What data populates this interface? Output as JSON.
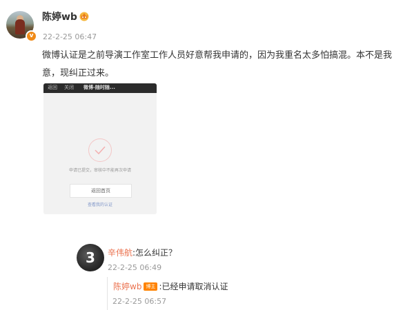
{
  "post": {
    "username": "陈婷wb",
    "verified_badge": "v",
    "time": "22-2-25 06:47",
    "content": "微博认证是之前导演工作室工作人员好意帮我申请的，因为我重名太多怕搞混。本不是我意，现纠正过来。",
    "screenshot": {
      "nav_back": "返回",
      "nav_close": "关闭",
      "nav_title": "微博-随时随...",
      "message": "申请已提交，审核中不能再次申请",
      "button": "返回首页",
      "link": "查看我的认证"
    }
  },
  "comment": {
    "avatar_text": "3",
    "username": "辛伟航",
    "text": ":怎么纠正？",
    "time": "22-2-25 06:49"
  },
  "reply": {
    "username": "陈婷wb",
    "tag": "博主",
    "text": ":已经申请取消认证",
    "time": "22-2-25 06:57"
  },
  "colors": {
    "username_link": "#eb7350",
    "badge": "#f08a17",
    "tag": "#ff8200"
  }
}
